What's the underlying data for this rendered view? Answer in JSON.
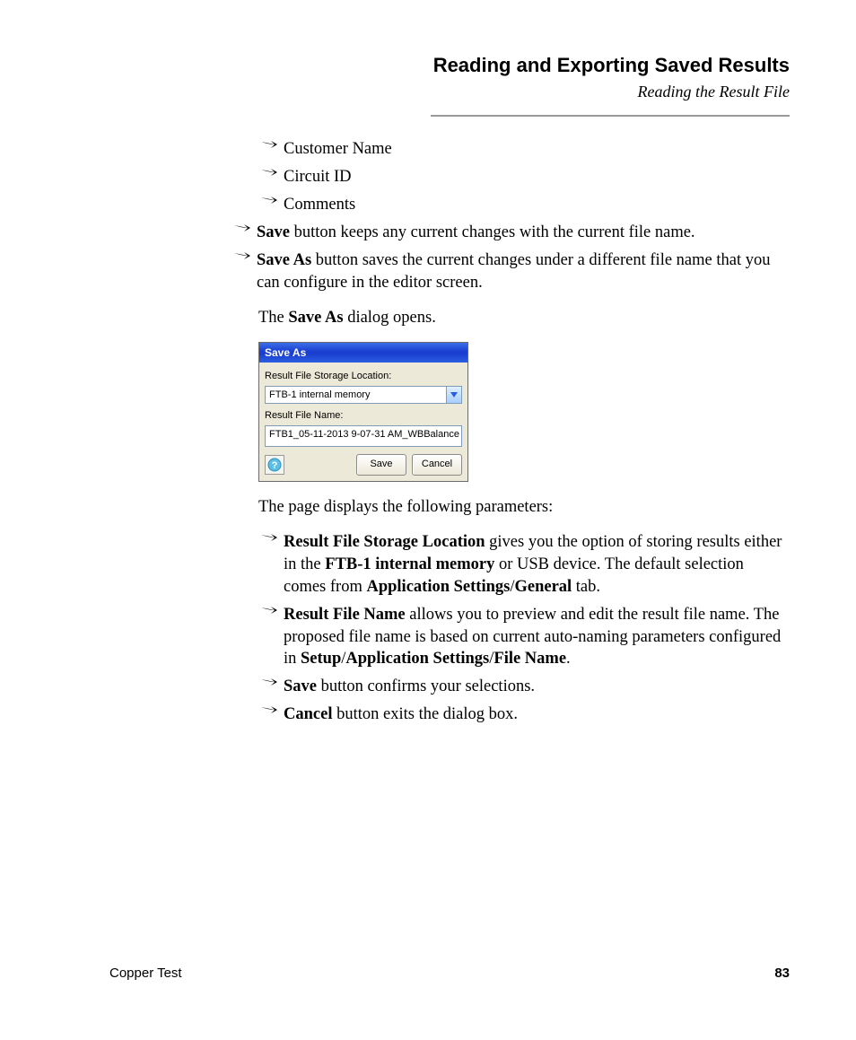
{
  "header": {
    "title": "Reading and Exporting Saved Results",
    "subtitle": "Reading the Result File"
  },
  "top_list": [
    "Customer Name",
    "Circuit ID",
    "Comments"
  ],
  "mid_list": [
    {
      "bold": "Save",
      "text": " button keeps any current changes with the current file name."
    },
    {
      "bold": "Save As",
      "text": " button saves the current changes under a different file name that you can configure in the editor screen."
    }
  ],
  "dialog_intro_prefix": "The ",
  "dialog_intro_bold": "Save As",
  "dialog_intro_suffix": " dialog opens.",
  "saveas": {
    "title": "Save As",
    "storage_label": "Result File Storage Location:",
    "storage_value": "FTB-1 internal memory",
    "filename_label": "Result File Name:",
    "filename_value": "FTB1_05-11-2013 9-07-31 AM_WBBalance",
    "save_btn": "Save",
    "cancel_btn": "Cancel"
  },
  "params_intro": "The page displays the following parameters:",
  "params": [
    {
      "bold": "Result File Storage Location",
      "after_bold": " gives you the option of storing results either in the ",
      "bold2": "FTB-1 internal memory",
      "after_bold2": " or USB device. The default selection comes from ",
      "bold3": "Application Settings",
      "after_bold3": "/",
      "bold4": "General",
      "after_bold4": " tab."
    },
    {
      "bold": "Result File Name",
      "after_bold": " allows you to preview and edit the result file name. The proposed file name is based on current auto-naming parameters configured in ",
      "bold2": "Setup",
      "after_bold2": "/",
      "bold3": "Application Settings",
      "after_bold3": "/",
      "bold4": "File Name",
      "after_bold4": "."
    },
    {
      "bold": "Save",
      "after_bold": " button confirms your selections."
    },
    {
      "bold": "Cancel",
      "after_bold": " button exits the dialog box."
    }
  ],
  "footer": {
    "left": "Copper Test",
    "right": "83"
  }
}
